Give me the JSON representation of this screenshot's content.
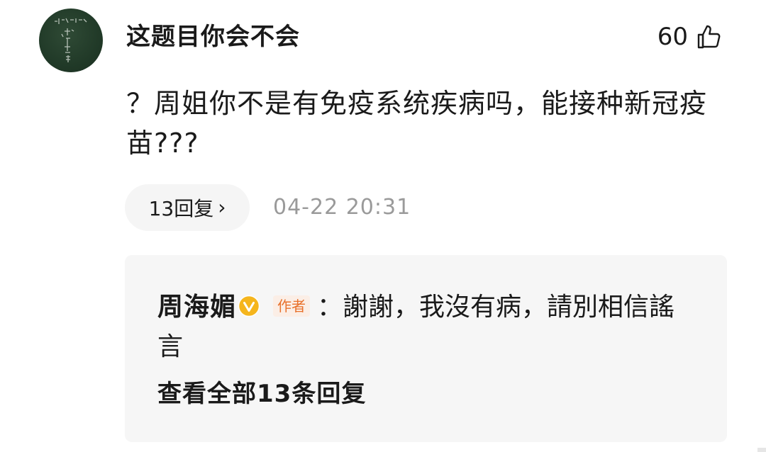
{
  "comment": {
    "username": "这题目你会不会",
    "like_count": "60",
    "text": "？周姐你不是有免疫系统疾病吗，能接种新冠疫苗???",
    "reply_count_label": "13回复",
    "reply_chevron": "›",
    "timestamp": "04-22 20:31"
  },
  "reply_preview": {
    "author": "周海媚",
    "author_tag": "作者",
    "separator": "：",
    "text": "謝謝，我沒有病，請別相信謠言",
    "view_all_label": "查看全部13条回复"
  },
  "icons": {
    "like": "thumbs-up-outline-icon",
    "verified": "verified-v-badge-icon",
    "avatar": "chalkboard-handwriting-avatar"
  },
  "colors": {
    "text_primary": "#1a1a1a",
    "text_secondary": "#9a9a9a",
    "pill_bg": "#f5f5f5",
    "reply_box_bg": "#f6f6f6",
    "verified_gold": "#f5b51d",
    "author_tag_text": "#e8702a",
    "author_tag_bg": "#fbeee6"
  }
}
